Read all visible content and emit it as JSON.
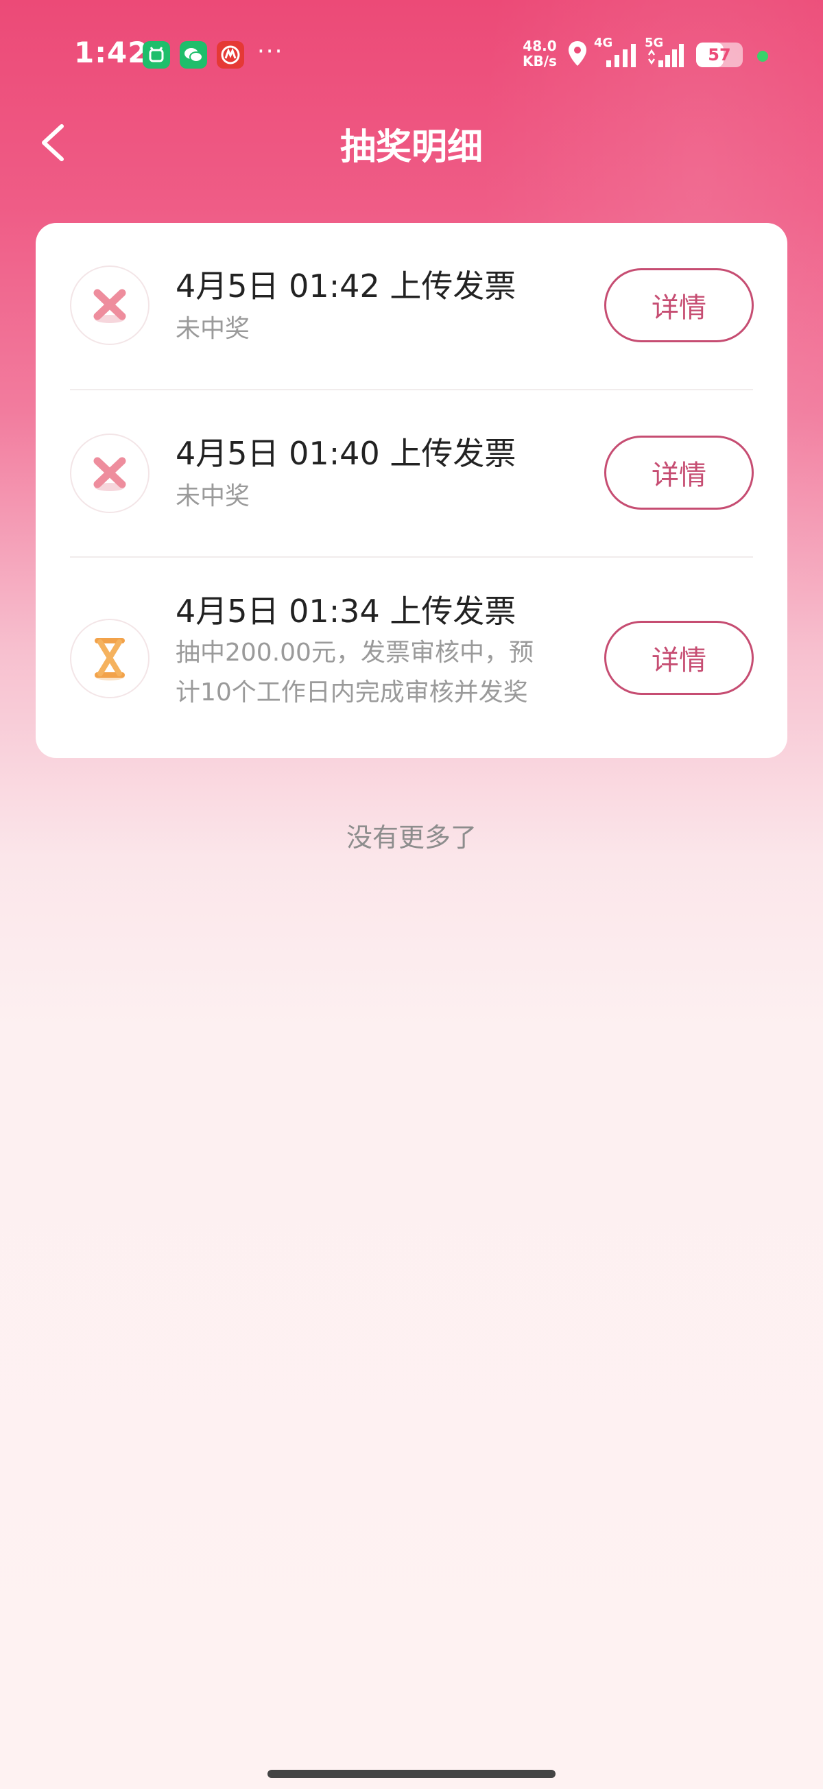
{
  "status_bar": {
    "time": "1:42",
    "net_speed_value": "48.0",
    "net_speed_unit": "KB/s",
    "signal_1": "4G",
    "signal_2": "5G",
    "battery": "57"
  },
  "header": {
    "title": "抽奖明细"
  },
  "records": [
    {
      "title": "4月5日 01:42 上传发票",
      "status_line1": "未中奖",
      "status_line2": "",
      "status_icon": "x-icon",
      "button_label": "详情"
    },
    {
      "title": "4月5日 01:40 上传发票",
      "status_line1": "未中奖",
      "status_line2": "",
      "status_icon": "x-icon",
      "button_label": "详情"
    },
    {
      "title": "4月5日 01:34 上传发票",
      "status_line1": "抽中200.00元，发票审核中，预",
      "status_line2": "计10个工作日内完成审核并发奖",
      "status_icon": "hourglass-icon",
      "button_label": "详情"
    }
  ],
  "footer": {
    "no_more": "没有更多了"
  },
  "colors": {
    "accent": "#c64d72",
    "header_pink": "#ec4a77"
  }
}
